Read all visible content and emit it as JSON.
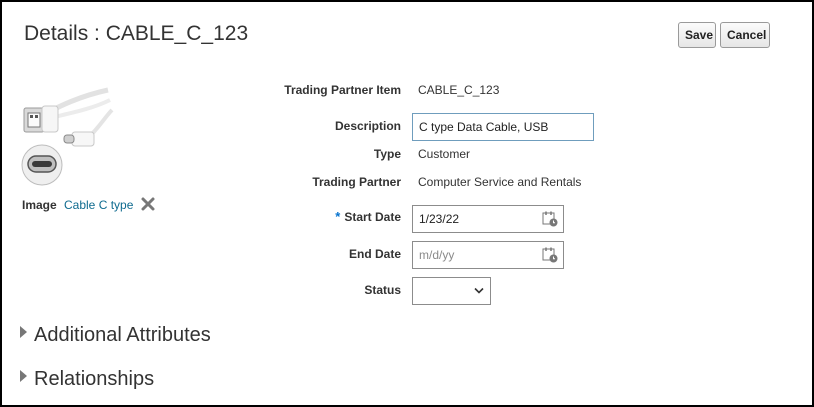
{
  "header": {
    "title": "Details : CABLE_C_123",
    "save_label": "Save",
    "cancel_label": "Cancel"
  },
  "image": {
    "label": "Image",
    "link_text": "Cable C type",
    "icons": [
      "usb-cable-image",
      "remove-icon"
    ]
  },
  "fields": {
    "trading_partner_item": {
      "label": "Trading Partner Item",
      "value": "CABLE_C_123"
    },
    "description": {
      "label": "Description",
      "value": "C type Data Cable, USB"
    },
    "type": {
      "label": "Type",
      "value": "Customer"
    },
    "trading_partner": {
      "label": "Trading Partner",
      "value": "Computer Service and Rentals"
    },
    "start_date": {
      "label": "Start Date",
      "required_marker": "*",
      "value": "1/23/22",
      "placeholder": ""
    },
    "end_date": {
      "label": "End Date",
      "value": "",
      "placeholder": "m/d/yy"
    },
    "status": {
      "label": "Status",
      "value": ""
    }
  },
  "sections": [
    {
      "label": "Additional Attributes"
    },
    {
      "label": "Relationships"
    }
  ],
  "colors": {
    "link": "#0f6b8f",
    "required": "#0572ce",
    "input_border": "#6f9dbd"
  }
}
